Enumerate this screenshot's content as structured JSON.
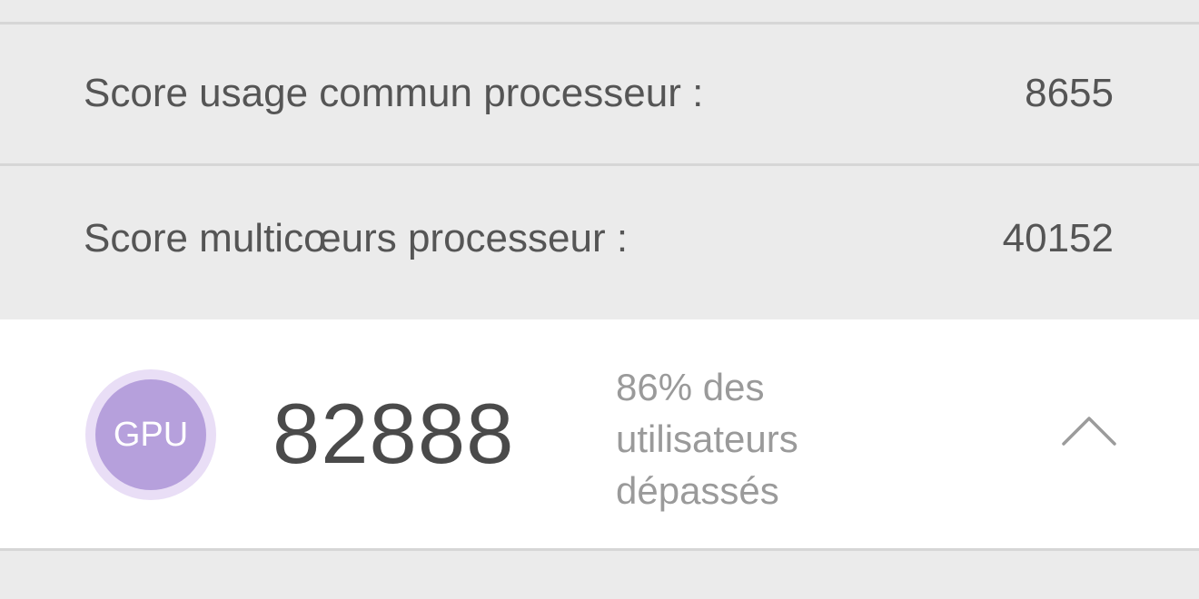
{
  "scores": [
    {
      "label": "Score usage commun processeur :",
      "value": "8655"
    },
    {
      "label": "Score multicœurs processeur :",
      "value": "40152"
    }
  ],
  "gpu": {
    "badge_label": "GPU",
    "score": "82888",
    "percentile_text": "86% des utilisateurs dépassés",
    "expand_icon": "chevron-up-icon",
    "badge_color": "#b6a0dc",
    "badge_ring_color": "#e9def6"
  }
}
